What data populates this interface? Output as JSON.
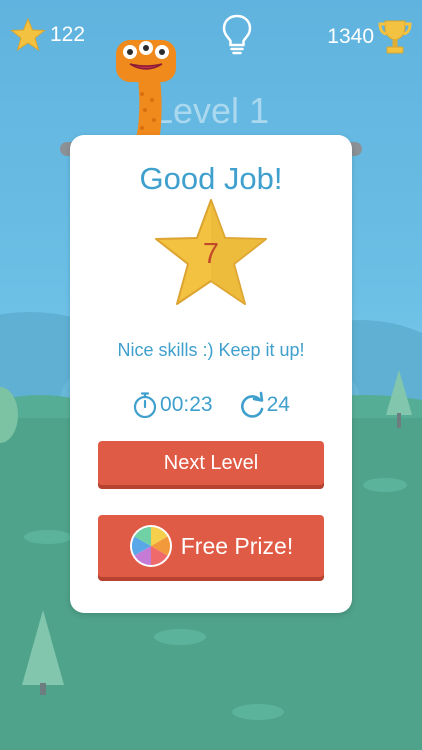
{
  "hud": {
    "stars_count": "122",
    "trophy_count": "1340"
  },
  "level": {
    "title": "Level 1"
  },
  "result": {
    "title": "Good Job!",
    "star_number": "7",
    "message": "Nice skills :) Keep it up!",
    "time": "00:23",
    "moves": "24"
  },
  "buttons": {
    "next_level": "Next Level",
    "free_prize": "Free Prize!"
  },
  "icons": {
    "stars": "star-icon",
    "hint": "lightbulb-icon",
    "trophy": "trophy-icon",
    "timer": "stopwatch-icon",
    "moves": "refresh-icon",
    "prize": "color-wheel-icon"
  },
  "colors": {
    "accent_blue": "#3f9fcd",
    "button_red": "#e05b46",
    "star_gold": "#f3c241",
    "star_number": "#c14a2b"
  }
}
